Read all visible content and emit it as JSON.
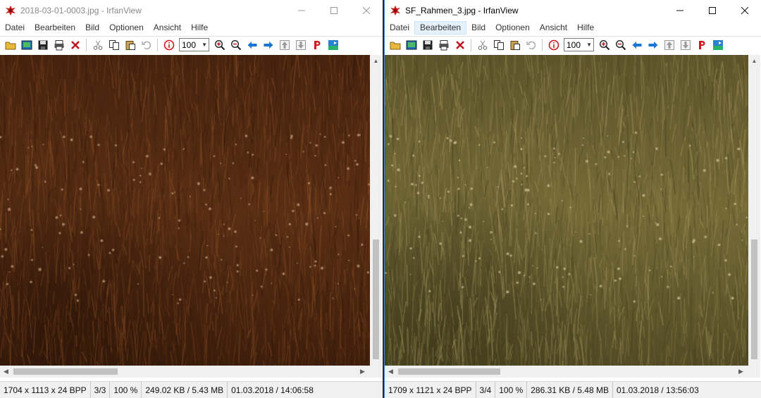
{
  "windows": [
    {
      "id": "left",
      "title": "2018-03-01-0003.jpg - IrfanView",
      "active": false,
      "menu": [
        "Datei",
        "Bearbeiten",
        "Bild",
        "Optionen",
        "Ansicht",
        "Hilfe"
      ],
      "zoom": "100",
      "status": {
        "dimensions": "1704 x 1113 x 24 BPP",
        "index": "3/3",
        "zoom": "100 %",
        "size": "249.02 KB / 5.43 MB",
        "datetime": "01.03.2018 / 14:06:58"
      },
      "image_tone": "reddish-brown"
    },
    {
      "id": "right",
      "title": "SF_Rahmen_3.jpg - IrfanView",
      "active": true,
      "menu": [
        "Datei",
        "Bearbeiten",
        "Bild",
        "Optionen",
        "Ansicht",
        "Hilfe"
      ],
      "highlighted_menu": "Bearbeiten",
      "zoom": "100",
      "status": {
        "dimensions": "1709 x 1121 x 24 BPP",
        "index": "3/4",
        "zoom": "100 %",
        "size": "286.31 KB / 5.48 MB",
        "datetime": "01.03.2018 / 13:56:03"
      },
      "image_tone": "olive-green"
    }
  ],
  "icons": {
    "toolbar": [
      "open-folder-icon",
      "slideshow-icon",
      "save-icon",
      "print-icon",
      "delete-icon",
      "cut-icon",
      "copy-icon",
      "paste-icon",
      "undo-icon",
      "info-icon",
      "zoom-in-icon",
      "zoom-out-icon",
      "previous-icon",
      "next-icon",
      "first-icon",
      "last-icon",
      "paint-icon",
      "settings-icon"
    ],
    "caption": [
      "minimize-icon",
      "maximize-icon",
      "close-icon"
    ]
  },
  "colors": {
    "left_image_dark": "#2e1609",
    "left_image_mid": "#5a2f14",
    "left_image_light": "#9a5a2c",
    "right_image_dark": "#3f3a1c",
    "right_image_mid": "#766b38",
    "right_image_light": "#b4a36a",
    "active_border": "#4a86c8",
    "menu_highlight": "#e5f1fb"
  }
}
